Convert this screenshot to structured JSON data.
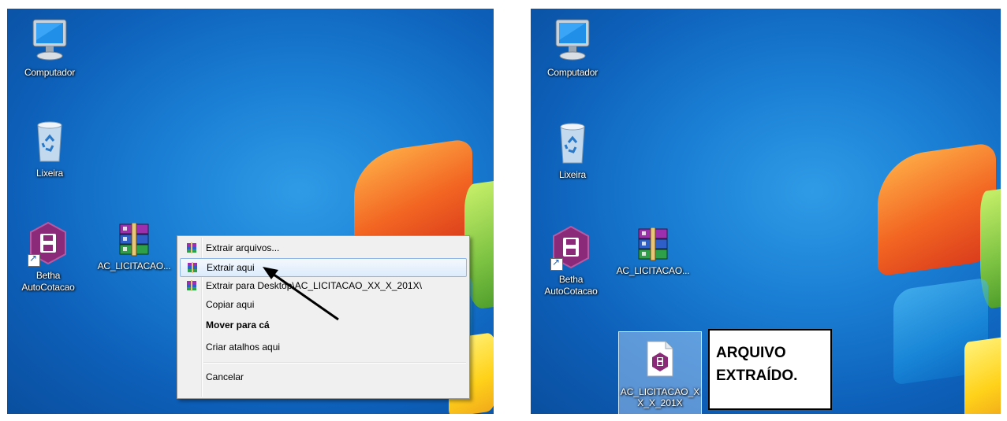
{
  "left_screenshot": {
    "desktop_icons": [
      {
        "label": "Computador",
        "icon": "computer-icon"
      },
      {
        "label": "Lixeira",
        "icon": "recycle-bin-icon"
      },
      {
        "label_line1": "Betha",
        "label_line2": "AutoCotacao",
        "icon": "betha-autocotacao-icon"
      },
      {
        "label": "AC_LICITACAO...",
        "icon": "winrar-archive-icon"
      }
    ],
    "context_menu": {
      "items": [
        {
          "label": "Extrair arquivos...",
          "icon": "winrar-icon"
        },
        {
          "label": "Extrair aqui",
          "icon": "winrar-icon",
          "highlighted": true
        },
        {
          "label": "Extrair para Desktop\\AC_LICITACAO_XX_X_201X\\",
          "icon": "winrar-icon"
        },
        {
          "label": "Copiar aqui"
        },
        {
          "label": "Mover para cá",
          "bold": true
        },
        {
          "label": "Criar atalhos aqui"
        },
        {
          "label": "Cancelar"
        }
      ]
    }
  },
  "right_screenshot": {
    "desktop_icons": [
      {
        "label": "Computador",
        "icon": "computer-icon"
      },
      {
        "label": "Lixeira",
        "icon": "recycle-bin-icon"
      },
      {
        "label_line1": "Betha",
        "label_line2": "AutoCotacao",
        "icon": "betha-autocotacao-icon"
      },
      {
        "label": "AC_LICITACAO...",
        "icon": "winrar-archive-icon"
      }
    ],
    "extracted_file": {
      "label_line1": "AC_LICITACAO_X",
      "label_line2": "X_X_201X",
      "icon": "betha-file-icon"
    },
    "callout": {
      "line1": "ARQUIVO",
      "line2": "EXTRAÍDO."
    }
  },
  "colors": {
    "desktop_blue": "#1a7fd4",
    "menu_highlight": "#dcebfc",
    "betha_purple": "#8b2a78"
  }
}
